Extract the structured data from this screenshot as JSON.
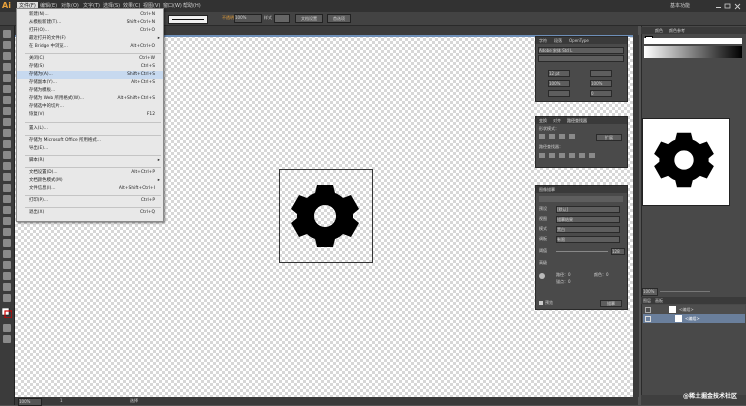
{
  "app": {
    "logo_text": "Ai",
    "workspace": "基本功能"
  },
  "menubar": {
    "items": [
      "文件(F)",
      "编辑(E)",
      "对象(O)",
      "文字(T)",
      "选择(S)",
      "效果(C)",
      "视图(V)",
      "窗口(W)",
      "帮助(H)"
    ]
  },
  "control_bar": {
    "opacity_label": "不透明度",
    "opacity_value": "100%",
    "style_label": "样式",
    "doc_settings": "文档设置",
    "prefs": "首选项"
  },
  "file_menu": {
    "items": [
      {
        "label": "新建(N)...",
        "shortcut": "Ctrl+N"
      },
      {
        "label": "从模板新建(T)...",
        "shortcut": "Shift+Ctrl+N"
      },
      {
        "label": "打开(O)...",
        "shortcut": "Ctrl+O"
      },
      {
        "label": "最近打开的文件(F)",
        "shortcut": "",
        "submenu": true
      },
      {
        "label": "在 Bridge 中浏览...",
        "shortcut": "Alt+Ctrl+O"
      },
      {
        "label": "关闭(C)",
        "shortcut": "Ctrl+W"
      },
      {
        "label": "存储(S)",
        "shortcut": "Ctrl+S"
      },
      {
        "label": "存储为(A)...",
        "shortcut": "Shift+Ctrl+S"
      },
      {
        "label": "存储副本(Y)...",
        "shortcut": "Alt+Ctrl+S"
      },
      {
        "label": "存储为模板...",
        "shortcut": ""
      },
      {
        "label": "存储为 Web 所用格式(W)...",
        "shortcut": "Alt+Shift+Ctrl+S"
      },
      {
        "label": "存储选中的切片...",
        "shortcut": ""
      },
      {
        "label": "恢复(V)",
        "shortcut": "F12"
      },
      {
        "label": "置入(L)...",
        "shortcut": ""
      },
      {
        "label": "存储为 Microsoft Office 所用格式...",
        "shortcut": ""
      },
      {
        "label": "导出(E)...",
        "shortcut": ""
      },
      {
        "label": "脚本(R)",
        "shortcut": "",
        "submenu": true
      },
      {
        "label": "文档设置(D)...",
        "shortcut": "Alt+Ctrl+P"
      },
      {
        "label": "文档颜色模式(M)",
        "shortcut": "",
        "submenu": true
      },
      {
        "label": "文件信息(I)...",
        "shortcut": "Alt+Shift+Ctrl+I"
      },
      {
        "label": "打印(P)...",
        "shortcut": "Ctrl+P"
      },
      {
        "label": "退出(X)",
        "shortcut": "Ctrl+Q"
      }
    ]
  },
  "char_panel": {
    "tabs": [
      "字符",
      "段落",
      "OpenType"
    ],
    "font": "Adobe 宋体 Std L",
    "size": "12 pt",
    "scale_h": "100%",
    "scale_v": "100%",
    "tracking": "0"
  },
  "path_panel": {
    "tabs": [
      "变换",
      "对齐",
      "路径查找器"
    ],
    "shape_mode_label": "形状模式：",
    "pathfinder_label": "路径查找器：",
    "expand": "扩展"
  },
  "image_trace_panel": {
    "title": "图像描摹",
    "preset_label": "预设",
    "preset_value": "[默认]",
    "view_label": "视图",
    "view_value": "描摹结果",
    "mode_label": "模式",
    "mode_value": "黑白",
    "palette_label": "调板",
    "palette_value": "有限",
    "threshold_label": "阈值",
    "threshold_value": "128",
    "advanced": "高级",
    "paths_label": "路径：0",
    "colors_label": "颜色：0",
    "anchors_label": "锚点：0",
    "preview": "预览",
    "trace_btn": "描摹"
  },
  "right_dock": {
    "tabs": [
      "颜色",
      "颜色参考"
    ],
    "zoom": "100%",
    "layers_tabs": [
      "图层",
      "画板"
    ],
    "layer_names": [
      "<编组>",
      "<编组>"
    ]
  },
  "status": {
    "zoom": "100%",
    "page": "1",
    "tool": "选择"
  },
  "watermark": "@稀土掘金技术社区"
}
